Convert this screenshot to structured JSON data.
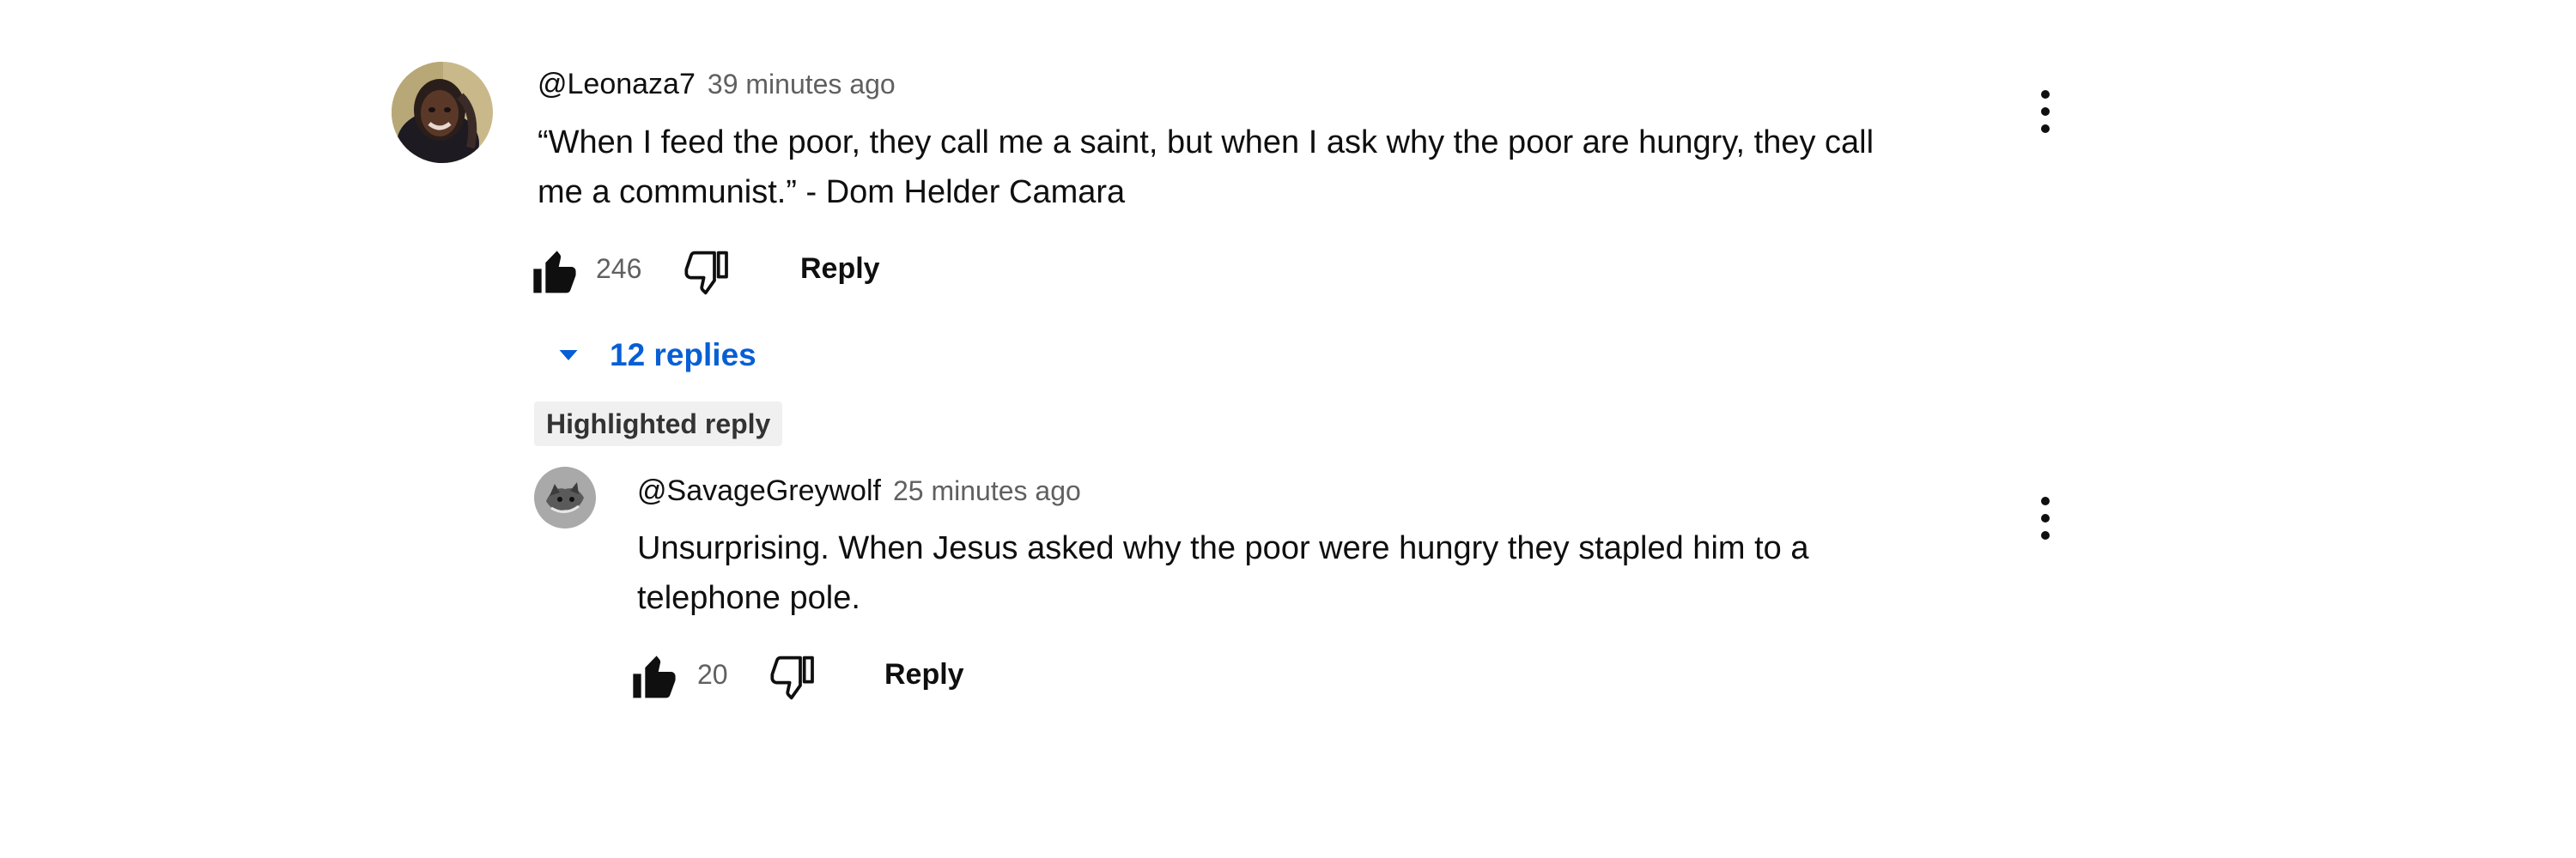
{
  "comments": [
    {
      "handle": "@Leonaza7",
      "time": "39 minutes ago",
      "text_line1": "“When I feed the poor, they call me a saint, but when I ask why the poor are hungry, they call",
      "text_line2": "me a communist.” - Dom Helder Camara",
      "likes": "246",
      "reply_label": "Reply",
      "avatar_icon": "user-avatar-photo",
      "more_icon": "more-vert-icon"
    }
  ],
  "replies_toggle": {
    "label": "12 replies",
    "icon": "caret-down-icon",
    "color": "#065fd4"
  },
  "highlight_badge": "Highlighted reply",
  "reply": {
    "handle": "@SavageGreywolf",
    "time": "25 minutes ago",
    "text_line1": "Unsurprising. When Jesus asked why the poor were hungry they stapled him to a",
    "text_line2": "telephone pole.",
    "likes": "20",
    "reply_label": "Reply",
    "avatar_icon": "wolf-avatar-image",
    "more_icon": "more-vert-icon"
  },
  "icons": {
    "like": "thumb-up-icon",
    "dislike": "thumb-down-icon"
  }
}
